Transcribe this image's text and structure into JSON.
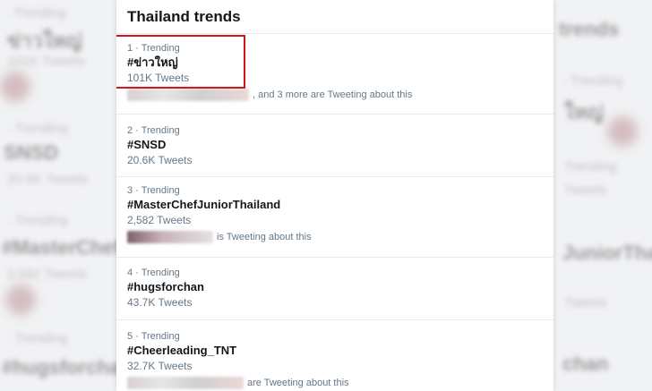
{
  "panel": {
    "title": "Thailand trends"
  },
  "trends": [
    {
      "meta": "1 · Trending",
      "tag": "#ข่าวใหญ่",
      "count": "101K Tweets",
      "about": ", and 3 more are Tweeting about this"
    },
    {
      "meta": "2 · Trending",
      "tag": "#SNSD",
      "count": "20.6K Tweets",
      "about": ""
    },
    {
      "meta": "3 · Trending",
      "tag": "#MasterChefJuniorThailand",
      "count": "2,582 Tweets",
      "about": "is Tweeting about this"
    },
    {
      "meta": "4 · Trending",
      "tag": "#hugsforchan",
      "count": "43.7K Tweets",
      "about": ""
    },
    {
      "meta": "5 · Trending",
      "tag": "#Cheerleading_TNT",
      "count": "32.7K Tweets",
      "about": "are Tweeting about this"
    }
  ],
  "colors": {
    "highlight": "#d0161e",
    "secondary_text": "#657786"
  }
}
